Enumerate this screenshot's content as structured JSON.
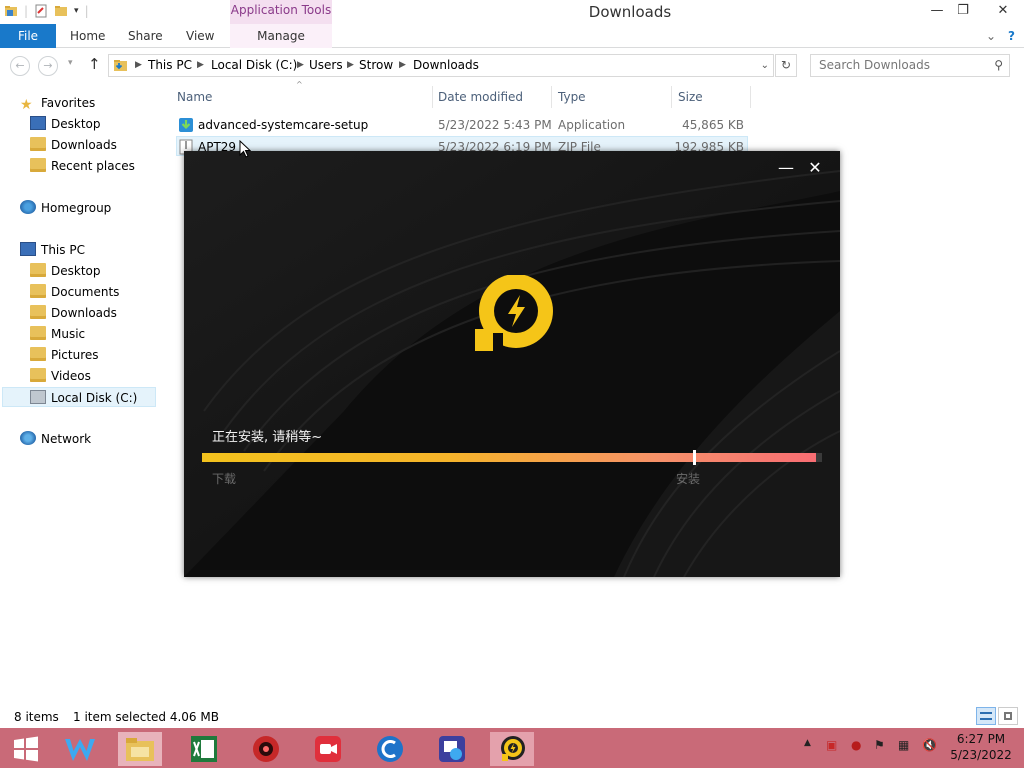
{
  "window": {
    "title": "Downloads",
    "contextual_group": "Application Tools",
    "controls": {
      "minimize": "—",
      "maximize": "❐",
      "close": "✕"
    }
  },
  "ribbon": {
    "file": "File",
    "tabs": [
      "Home",
      "Share",
      "View"
    ],
    "manage": "Manage",
    "expand": "⌄",
    "help": "?"
  },
  "address": {
    "crumbs": [
      "This PC",
      "Local Disk (C:)",
      "Users",
      "Strow",
      "Downloads"
    ],
    "search_placeholder": "Search Downloads"
  },
  "nav": {
    "favorites": {
      "label": "Favorites",
      "items": [
        "Desktop",
        "Downloads",
        "Recent places"
      ]
    },
    "homegroup": "Homegroup",
    "this_pc": {
      "label": "This PC",
      "items": [
        "Desktop",
        "Documents",
        "Downloads",
        "Music",
        "Pictures",
        "Videos",
        "Local Disk (C:)"
      ]
    },
    "network": "Network"
  },
  "columns": {
    "name": "Name",
    "date": "Date modified",
    "type": "Type",
    "size": "Size"
  },
  "files": [
    {
      "name": "advanced-systemcare-setup",
      "date": "5/23/2022 5:43 PM",
      "type": "Application",
      "size": "45,865 KB"
    },
    {
      "name": "APT29",
      "date": "5/23/2022 6:19 PM",
      "type": "ZIP File",
      "size": "192,985 KB"
    }
  ],
  "status": {
    "items": "8 items",
    "selected": "1 item selected  4.06 MB"
  },
  "installer": {
    "minimize": "—",
    "close": "✕",
    "message": "正在安装, 请稍等~",
    "progress_fraction": 0.99,
    "stage_marker_fraction": 0.792,
    "label_download": "下载",
    "label_install": "安装",
    "brand_color": "#f5c518"
  },
  "taskbar": {
    "clock_time": "6:27 PM",
    "clock_date": "5/23/2022",
    "accent": "#c96a78"
  }
}
